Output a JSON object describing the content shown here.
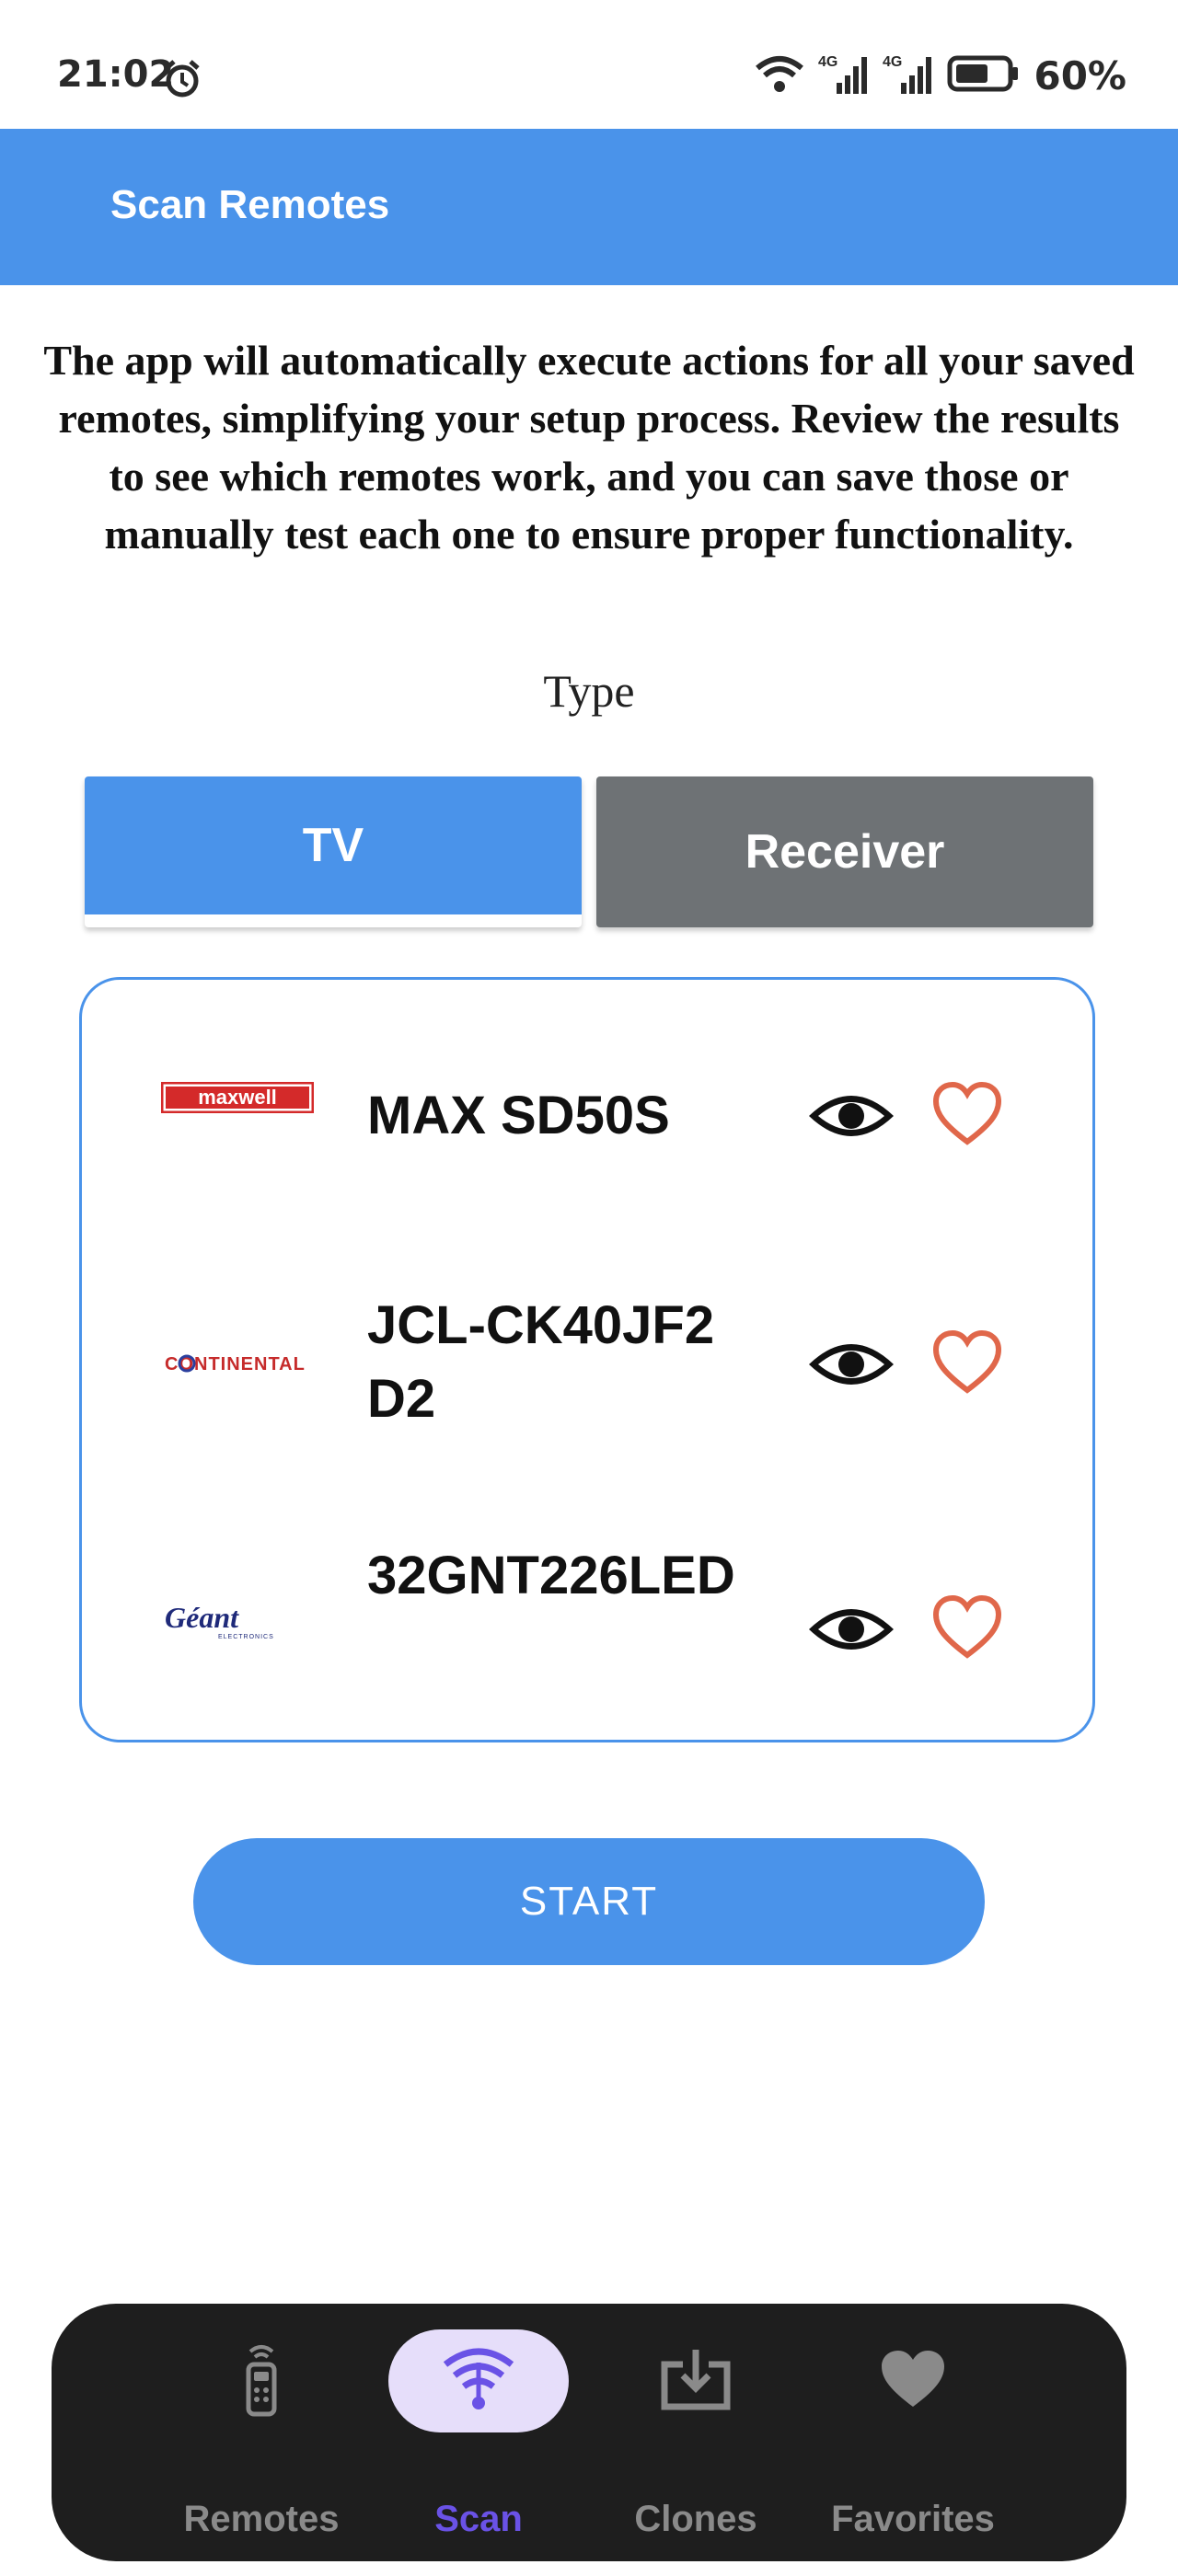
{
  "status_bar": {
    "time": "21:02",
    "battery": "60%",
    "network_1": "4G",
    "network_2": "4G"
  },
  "app_bar": {
    "title": "Scan Remotes"
  },
  "description": "The app will automatically execute actions for all your saved remotes, simplifying your setup process. Review the results to see which remotes work, and you can save those or manually test each one to ensure proper functionality.",
  "type_section": {
    "label": "Type",
    "tabs": [
      {
        "label": "TV",
        "selected": true
      },
      {
        "label": "Receiver",
        "selected": false
      }
    ]
  },
  "remotes": [
    {
      "brand": "maxwell",
      "model": "MAX SD50S"
    },
    {
      "brand": "CONTINENTAL",
      "model": "JCL-CK40JF2D2"
    },
    {
      "brand": "Géant",
      "brand_sub": "ELECTRONICS",
      "model": "32GNT226LED"
    }
  ],
  "start_button": {
    "label": "START"
  },
  "bottom_nav": {
    "items": [
      {
        "label": "Remotes",
        "icon": "remote-icon",
        "active": false
      },
      {
        "label": "Scan",
        "icon": "scan-wifi-icon",
        "active": true
      },
      {
        "label": "Clones",
        "icon": "download-box-icon",
        "active": false
      },
      {
        "label": "Favorites",
        "icon": "heart-filled-icon",
        "active": false
      }
    ]
  },
  "colors": {
    "primary": "#4a93ea",
    "inactive_tab": "#6e7275",
    "heart": "#e0674a",
    "nav_bg": "#1e1e1e",
    "nav_active": "#6a52e6",
    "nav_active_bg": "#e6defa"
  }
}
